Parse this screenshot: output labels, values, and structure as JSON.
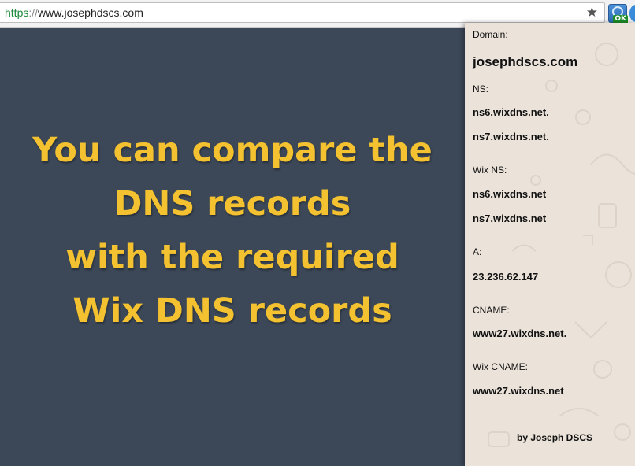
{
  "browser": {
    "url_scheme": "https",
    "url_separator": "://",
    "url_host": "www.josephdscs.com",
    "star_icon": "★",
    "extension_badge": "OK",
    "colors": {
      "scheme": "#1a8a3a",
      "toolbar": "#f2f2f2"
    }
  },
  "page": {
    "headline_lines": [
      "You can compare the",
      "DNS records",
      "with the required",
      "Wix DNS records"
    ],
    "colors": {
      "background": "#3c4858",
      "headline": "#f4c230"
    }
  },
  "popup": {
    "domain_label": "Domain:",
    "domain_value": "josephdscs.com",
    "ns_label": "NS:",
    "ns_values": [
      "ns6.wixdns.net.",
      "ns7.wixdns.net."
    ],
    "wix_ns_label": "Wix NS:",
    "wix_ns_values": [
      "ns6.wixdns.net",
      "ns7.wixdns.net"
    ],
    "a_label": "A:",
    "a_value": "23.236.62.147",
    "cname_label": "CNAME:",
    "cname_value": "www27.wixdns.net.",
    "wix_cname_label": "Wix CNAME:",
    "wix_cname_value": "www27.wixdns.net",
    "footer": "by Joseph DSCS",
    "colors": {
      "background": "#ebe3da"
    }
  }
}
